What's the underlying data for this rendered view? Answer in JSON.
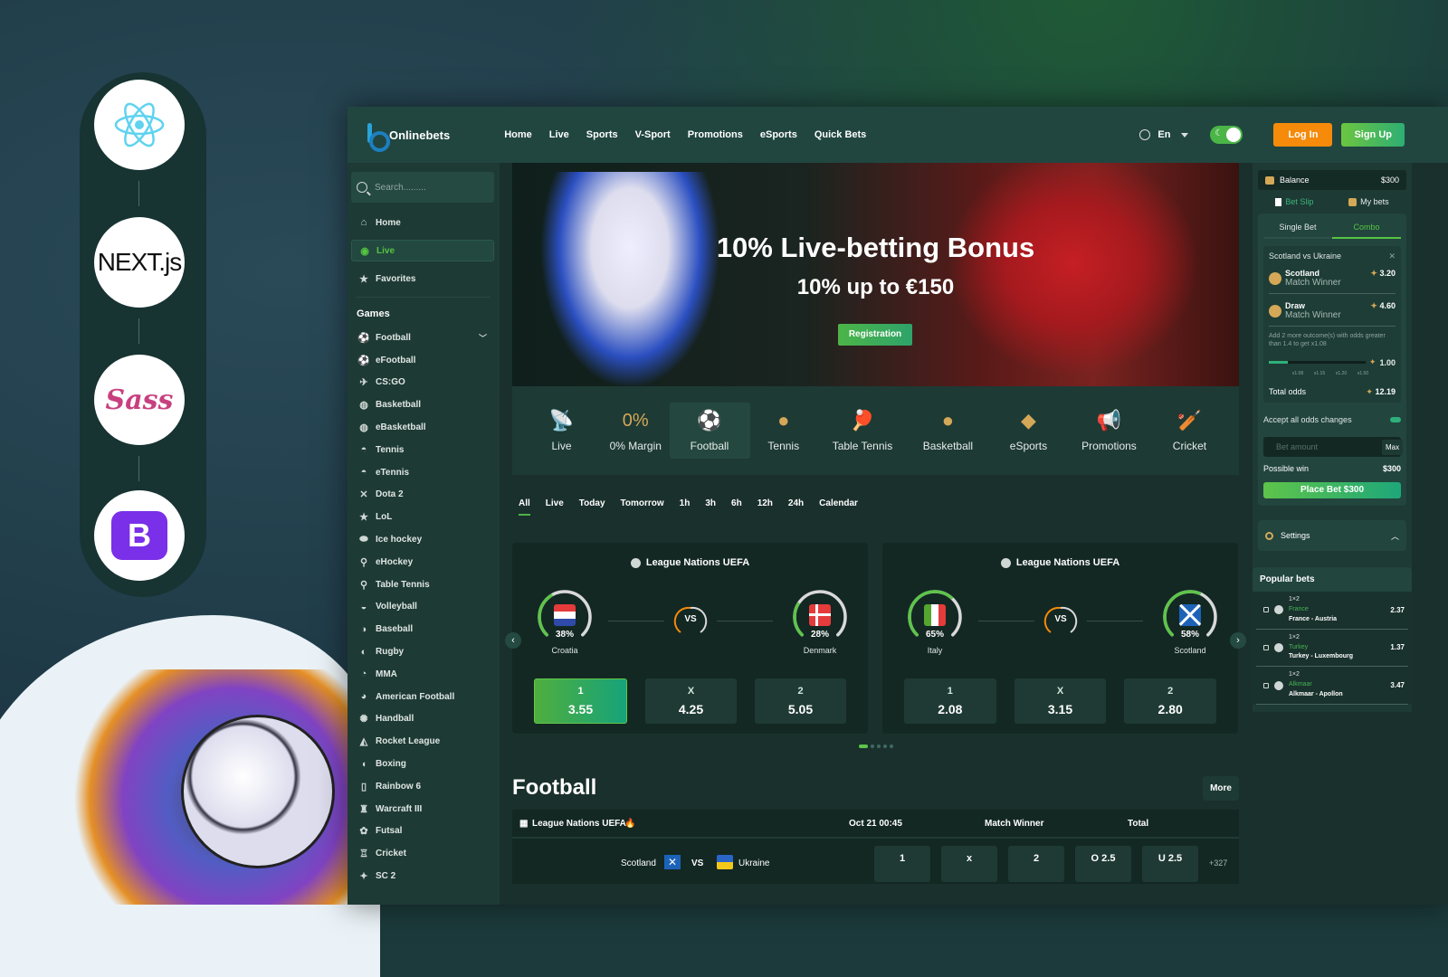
{
  "tech_badges": [
    "React",
    "NEXT.js",
    "Sass",
    "Bootstrap"
  ],
  "header": {
    "brand": "Onlinebets",
    "nav": [
      "Home",
      "Live",
      "Sports",
      "V-Sport",
      "Promotions",
      "eSports",
      "Quick Bets"
    ],
    "language": "En",
    "login_label": "Log In",
    "signup_label": "Sign Up",
    "theme_toggle_on": true
  },
  "sidebar": {
    "search_placeholder": "Search.........",
    "top_items": [
      {
        "label": "Home",
        "icon": "home-icon"
      },
      {
        "label": "Live",
        "icon": "live-icon",
        "active": true
      },
      {
        "label": "Favorites",
        "icon": "star-icon"
      }
    ],
    "games_heading": "Games",
    "games": [
      "Football",
      "eFootball",
      "CS:GO",
      "Basketball",
      "eBasketball",
      "Tennis",
      "eTennis",
      "Dota 2",
      "LoL",
      "Ice hockey",
      "eHockey",
      "Table Tennis",
      "Volleyball",
      "Baseball",
      "Rugby",
      "MMA",
      "American Football",
      "Handball",
      "Rocket League",
      "Boxing",
      "Rainbow 6",
      "Warcraft III",
      "Futsal",
      "Cricket",
      "SC 2"
    ]
  },
  "banner": {
    "title": "10% Live-betting Bonus",
    "subtitle": "10% up to €150",
    "button": "Registration"
  },
  "categories": [
    {
      "label": "Live",
      "icon": "live-icon"
    },
    {
      "label": "0% Margin",
      "icon": "zero-percent-icon"
    },
    {
      "label": "Football",
      "icon": "football-icon",
      "active": true
    },
    {
      "label": "Tennis",
      "icon": "tennis-icon"
    },
    {
      "label": "Table Tennis",
      "icon": "table-tennis-icon"
    },
    {
      "label": "Basketball",
      "icon": "basketball-icon"
    },
    {
      "label": "eSports",
      "icon": "esports-icon"
    },
    {
      "label": "Promotions",
      "icon": "megaphone-icon"
    },
    {
      "label": "Cricket",
      "icon": "cricket-icon"
    }
  ],
  "time_filters": [
    "All",
    "Live",
    "Today",
    "Tomorrow",
    "1h",
    "3h",
    "6h",
    "12h",
    "24h",
    "Calendar"
  ],
  "active_filter": "All",
  "featured_matches": [
    {
      "league": "League Nations UEFA",
      "home": {
        "name": "Croatia",
        "pct": "38%",
        "value": 0.38
      },
      "away": {
        "name": "Denmark",
        "pct": "28%",
        "value": 0.28
      },
      "vs": "VS",
      "odds": [
        {
          "k": "1",
          "v": "3.55",
          "selected": true
        },
        {
          "k": "X",
          "v": "4.25"
        },
        {
          "k": "2",
          "v": "5.05"
        }
      ]
    },
    {
      "league": "League Nations UEFA",
      "home": {
        "name": "Italy",
        "pct": "65%",
        "value": 0.65
      },
      "away": {
        "name": "Scotland",
        "pct": "58%",
        "value": 0.58
      },
      "vs": "VS",
      "odds": [
        {
          "k": "1",
          "v": "2.08"
        },
        {
          "k": "X",
          "v": "3.15"
        },
        {
          "k": "2",
          "v": "2.80"
        }
      ]
    }
  ],
  "carousel": {
    "pages": 5,
    "current": 1
  },
  "football_section": {
    "title": "Football",
    "more": "More",
    "table_header": {
      "league": "League Nations UEFA",
      "date": "Oct 21 00:45",
      "market1": "Match Winner",
      "market2": "Total"
    },
    "row": {
      "home": "Scotland",
      "vs": "VS",
      "away": "Ukraine",
      "cells": [
        "1",
        "x",
        "2",
        "O 2.5",
        "U 2.5"
      ],
      "more_count": "+327"
    }
  },
  "betslip": {
    "balance_label": "Balance",
    "balance": "$300",
    "tabs": [
      "Bet Slip",
      "My bets"
    ],
    "bet_types": [
      "Single Bet",
      "Combo"
    ],
    "active_bet_type": "Combo",
    "event": "Scotland vs Ukraine",
    "selections": [
      {
        "name": "Scotland",
        "market": "Match Winner",
        "odds": "3.20"
      },
      {
        "name": "Draw",
        "market": "Match Winner",
        "odds": "4.60"
      }
    ],
    "hint": "Add 2 more outcome(s) with odds greater than 1.4 to get x1.08",
    "boost_labels": [
      "x1.08",
      "x1.15",
      "x1.20",
      "x1.50"
    ],
    "boost_value": "1.00",
    "boost_progress": 0.2,
    "total_odds_label": "Total odds",
    "total_odds": "12.19",
    "accept_label": "Accept all odds changes",
    "amount_placeholder": "Bet amount",
    "max_label": "Max",
    "possible_win_label": "Possible win",
    "possible_win": "$300",
    "place_bet": "Place Bet $300",
    "settings": "Settings"
  },
  "popular_bets": {
    "title": "Popular bets",
    "items": [
      {
        "market": "1×2",
        "pick": "France",
        "event": "France - Austria",
        "odds": "2.37"
      },
      {
        "market": "1×2",
        "pick": "Turkey",
        "event": "Turkey - Luxembourg",
        "odds": "1.37"
      },
      {
        "market": "1×2",
        "pick": "Alkmaar",
        "event": "Alkmaar - Apollon",
        "odds": "3.47"
      }
    ]
  }
}
